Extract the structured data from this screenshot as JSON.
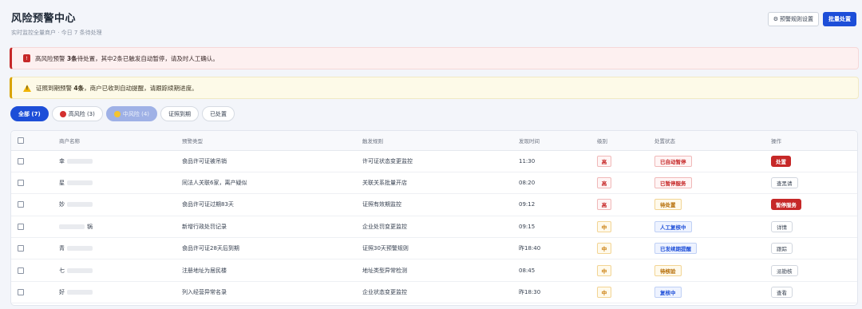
{
  "header": {
    "title": "风险预警中心",
    "subtitle": "实时监控全量商户 · 今日 7 条待处理",
    "settings_button": "预警规则设置",
    "batch_button": "批量处置"
  },
  "banners": {
    "red": {
      "prefix": "高风险预警 ",
      "bold": "3条",
      "suffix": "待处置，其中2条已触发自动暂停，请及时人工确认。"
    },
    "yellow": {
      "prefix": "证照到期预警 ",
      "bold": "4条",
      "suffix": "，商户已收到自动提醒，请跟踪续期进度。"
    }
  },
  "filters": [
    {
      "label": "全部 (7)"
    },
    {
      "label": "高风险 (3)"
    },
    {
      "label": "中风险 (4)"
    },
    {
      "label": "证照到期"
    },
    {
      "label": "已处置"
    }
  ],
  "table": {
    "headers": [
      "商户名称",
      "预警类型",
      "触发规则",
      "发现时间",
      "级别",
      "处置状态",
      "操作"
    ],
    "rows": [
      {
        "merchant": "幸",
        "type": "食品许可证被吊销",
        "rule": "许可证状态变更监控",
        "time": "11:30",
        "level": "高",
        "status": "已自动暂停",
        "action": "处置"
      },
      {
        "merchant": "星",
        "type": "同法人关联6家，离产疑似",
        "rule": "关联关系批量开店",
        "time": "08:20",
        "level": "高",
        "status": "已暂停服务",
        "action": "查黑请"
      },
      {
        "merchant": "妙",
        "type": "食品许可证过期83天",
        "rule": "证照有效期监控",
        "time": "09:12",
        "level": "高",
        "status": "待处置",
        "action": "暂停服务"
      },
      {
        "merchant": "锅",
        "type": "新增行政处罚记录",
        "rule": "企业处罚变更监控",
        "time": "09:15",
        "level": "中",
        "status": "人工复核中",
        "action": "详情"
      },
      {
        "merchant": "青",
        "type": "食品许可证28天后到期",
        "rule": "证照30天预警规则",
        "time": "昨18:40",
        "level": "中",
        "status": "已发续期提醒",
        "action": "跟踪"
      },
      {
        "merchant": "七",
        "type": "注册地址为居民楼",
        "rule": "地址类型异常检测",
        "time": "08:45",
        "level": "中",
        "status": "待核验",
        "action": "派勘核"
      },
      {
        "merchant": "好",
        "type": "列入经营异常名录",
        "rule": "企业状态变更监控",
        "time": "昨18:30",
        "level": "中",
        "status": "复核中",
        "action": "查看"
      }
    ]
  }
}
